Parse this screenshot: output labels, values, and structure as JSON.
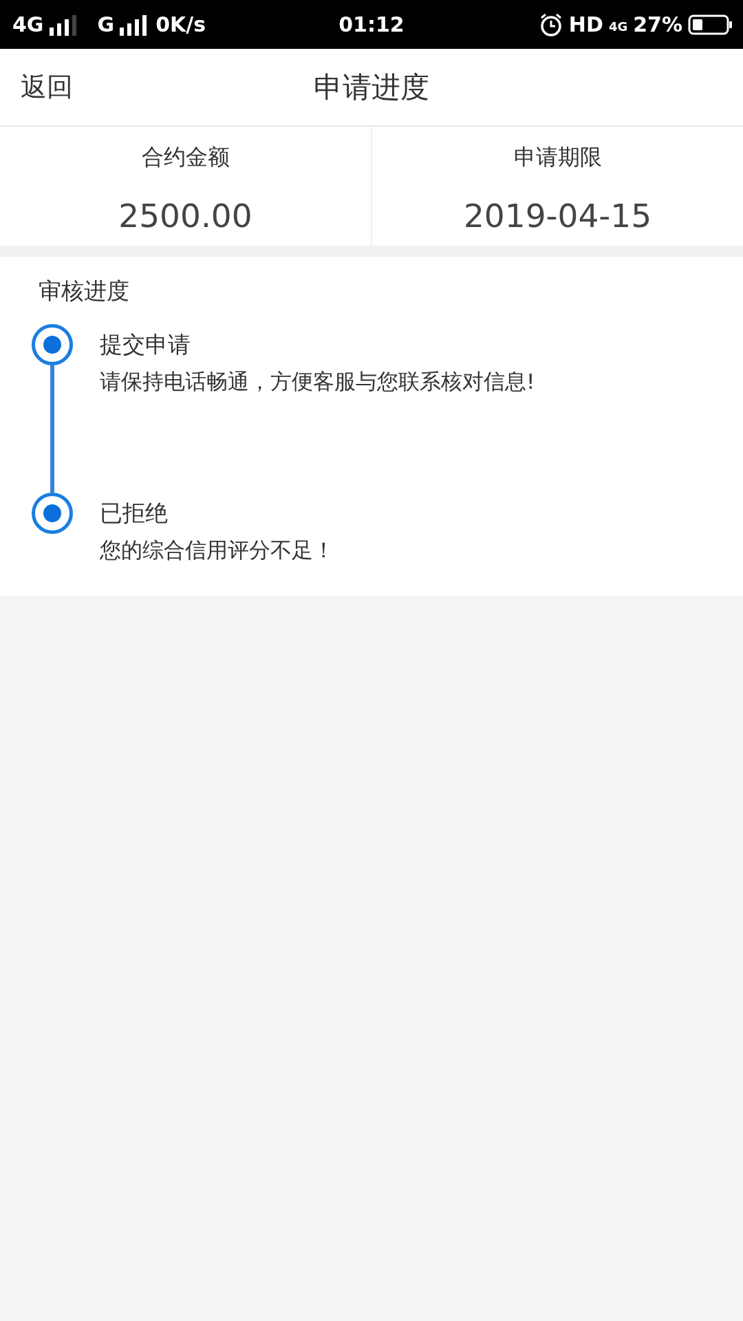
{
  "status_bar": {
    "network_1": "4G",
    "network_2": "G",
    "speed": "0K/s",
    "time": "01:12",
    "hd": "HD",
    "network_3": "4G",
    "battery": "27%"
  },
  "nav": {
    "back": "返回",
    "title": "申请进度"
  },
  "summary": [
    {
      "label": "合约金额",
      "value": "2500.00"
    },
    {
      "label": "申请期限",
      "value": "2019-04-15"
    }
  ],
  "progress": {
    "title": "审核进度",
    "steps": [
      {
        "title": "提交申请",
        "description": "请保持电话畅通，方便客服与您联系核对信息!"
      },
      {
        "title": "已拒绝",
        "description": "您的综合信用评分不足！"
      }
    ]
  }
}
